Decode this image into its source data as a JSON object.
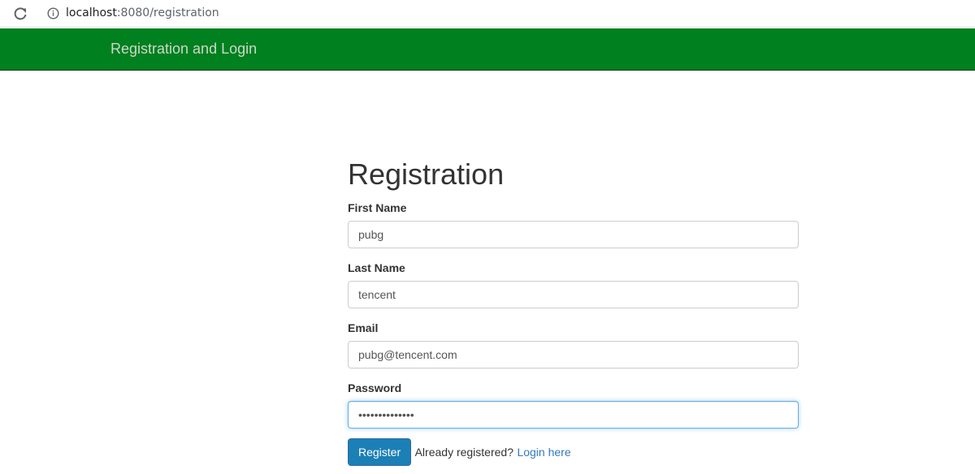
{
  "browser": {
    "url_host": "localhost",
    "url_rest": ":8080/registration",
    "icons": [
      "reload-icon",
      "info-icon"
    ]
  },
  "navbar": {
    "brand": "Registration and Login",
    "background_color": "#00801e"
  },
  "form": {
    "title": "Registration",
    "fields": [
      {
        "label": "First Name",
        "value": "pubg"
      },
      {
        "label": "Last Name",
        "value": "tencent"
      },
      {
        "label": "Email",
        "value": "pubg@tencent.com"
      },
      {
        "label": "Password",
        "value": "••••••••••••••",
        "focused": true
      }
    ],
    "register_label": "Register",
    "already_text": "Already registered?",
    "login_link": "Login here"
  },
  "colors": {
    "button": "#1c7fb5",
    "link": "#337ab7",
    "focus": "#66afe9"
  }
}
